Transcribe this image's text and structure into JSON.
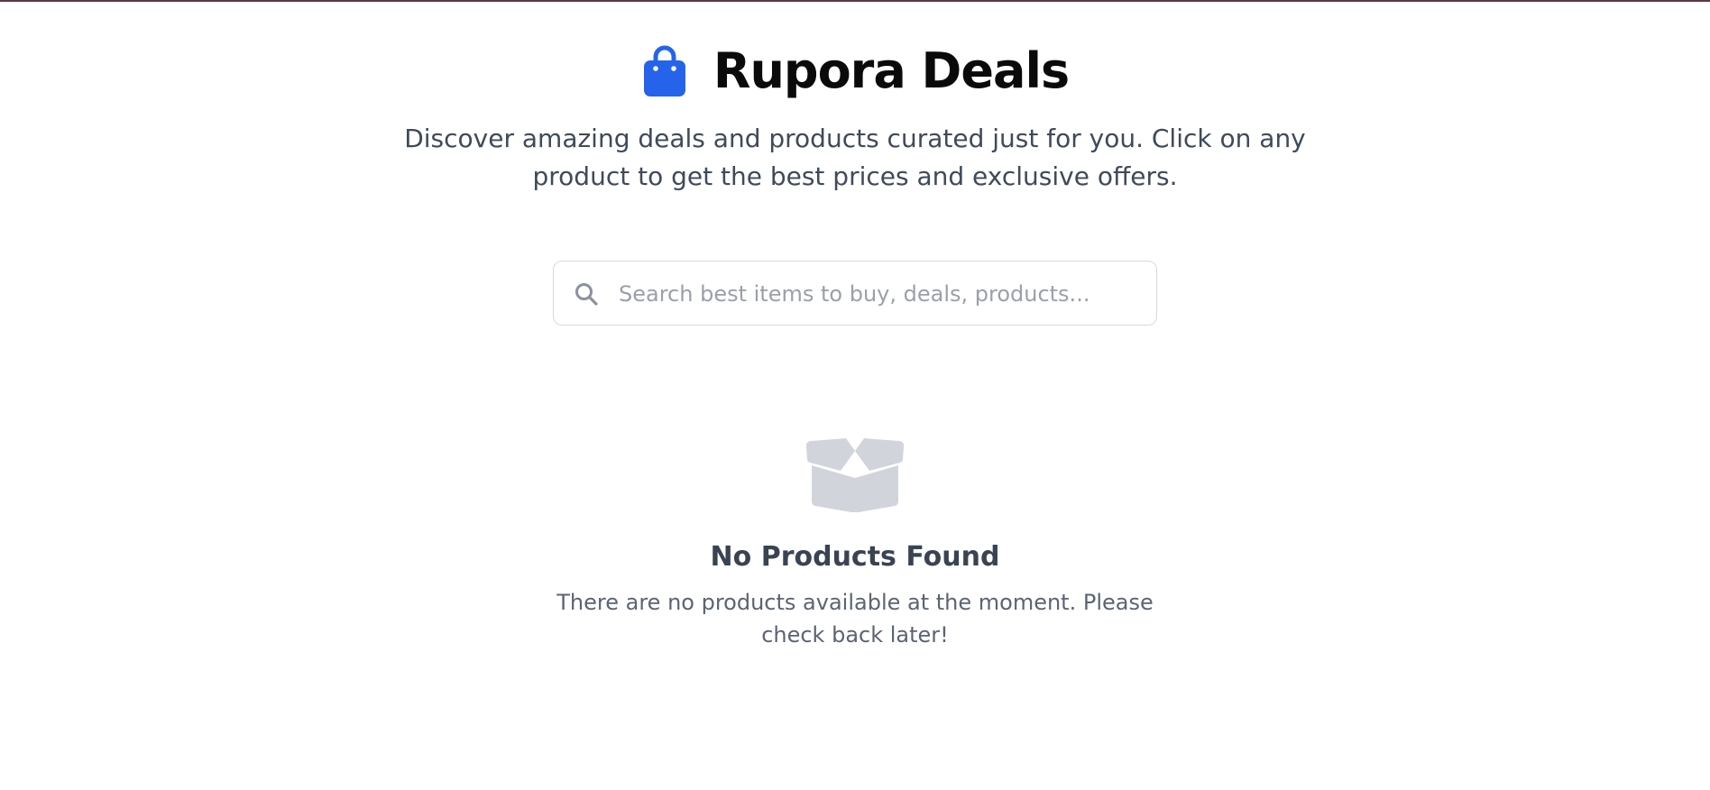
{
  "header": {
    "title": "Rupora Deals",
    "icon": "shopping-bag-icon",
    "icon_color": "#2563eb"
  },
  "subtitle": "Discover amazing deals and products curated just for you. Click on any product to get the best prices and exclusive offers.",
  "search": {
    "placeholder": "Search best items to buy, deals, products...",
    "value": "",
    "icon": "search-icon"
  },
  "empty_state": {
    "icon": "open-box-icon",
    "title": "No Products Found",
    "message": "There are no products available at the moment. Please check back later!"
  },
  "colors": {
    "accent": "#2563eb",
    "empty_icon": "#d1d5db"
  }
}
